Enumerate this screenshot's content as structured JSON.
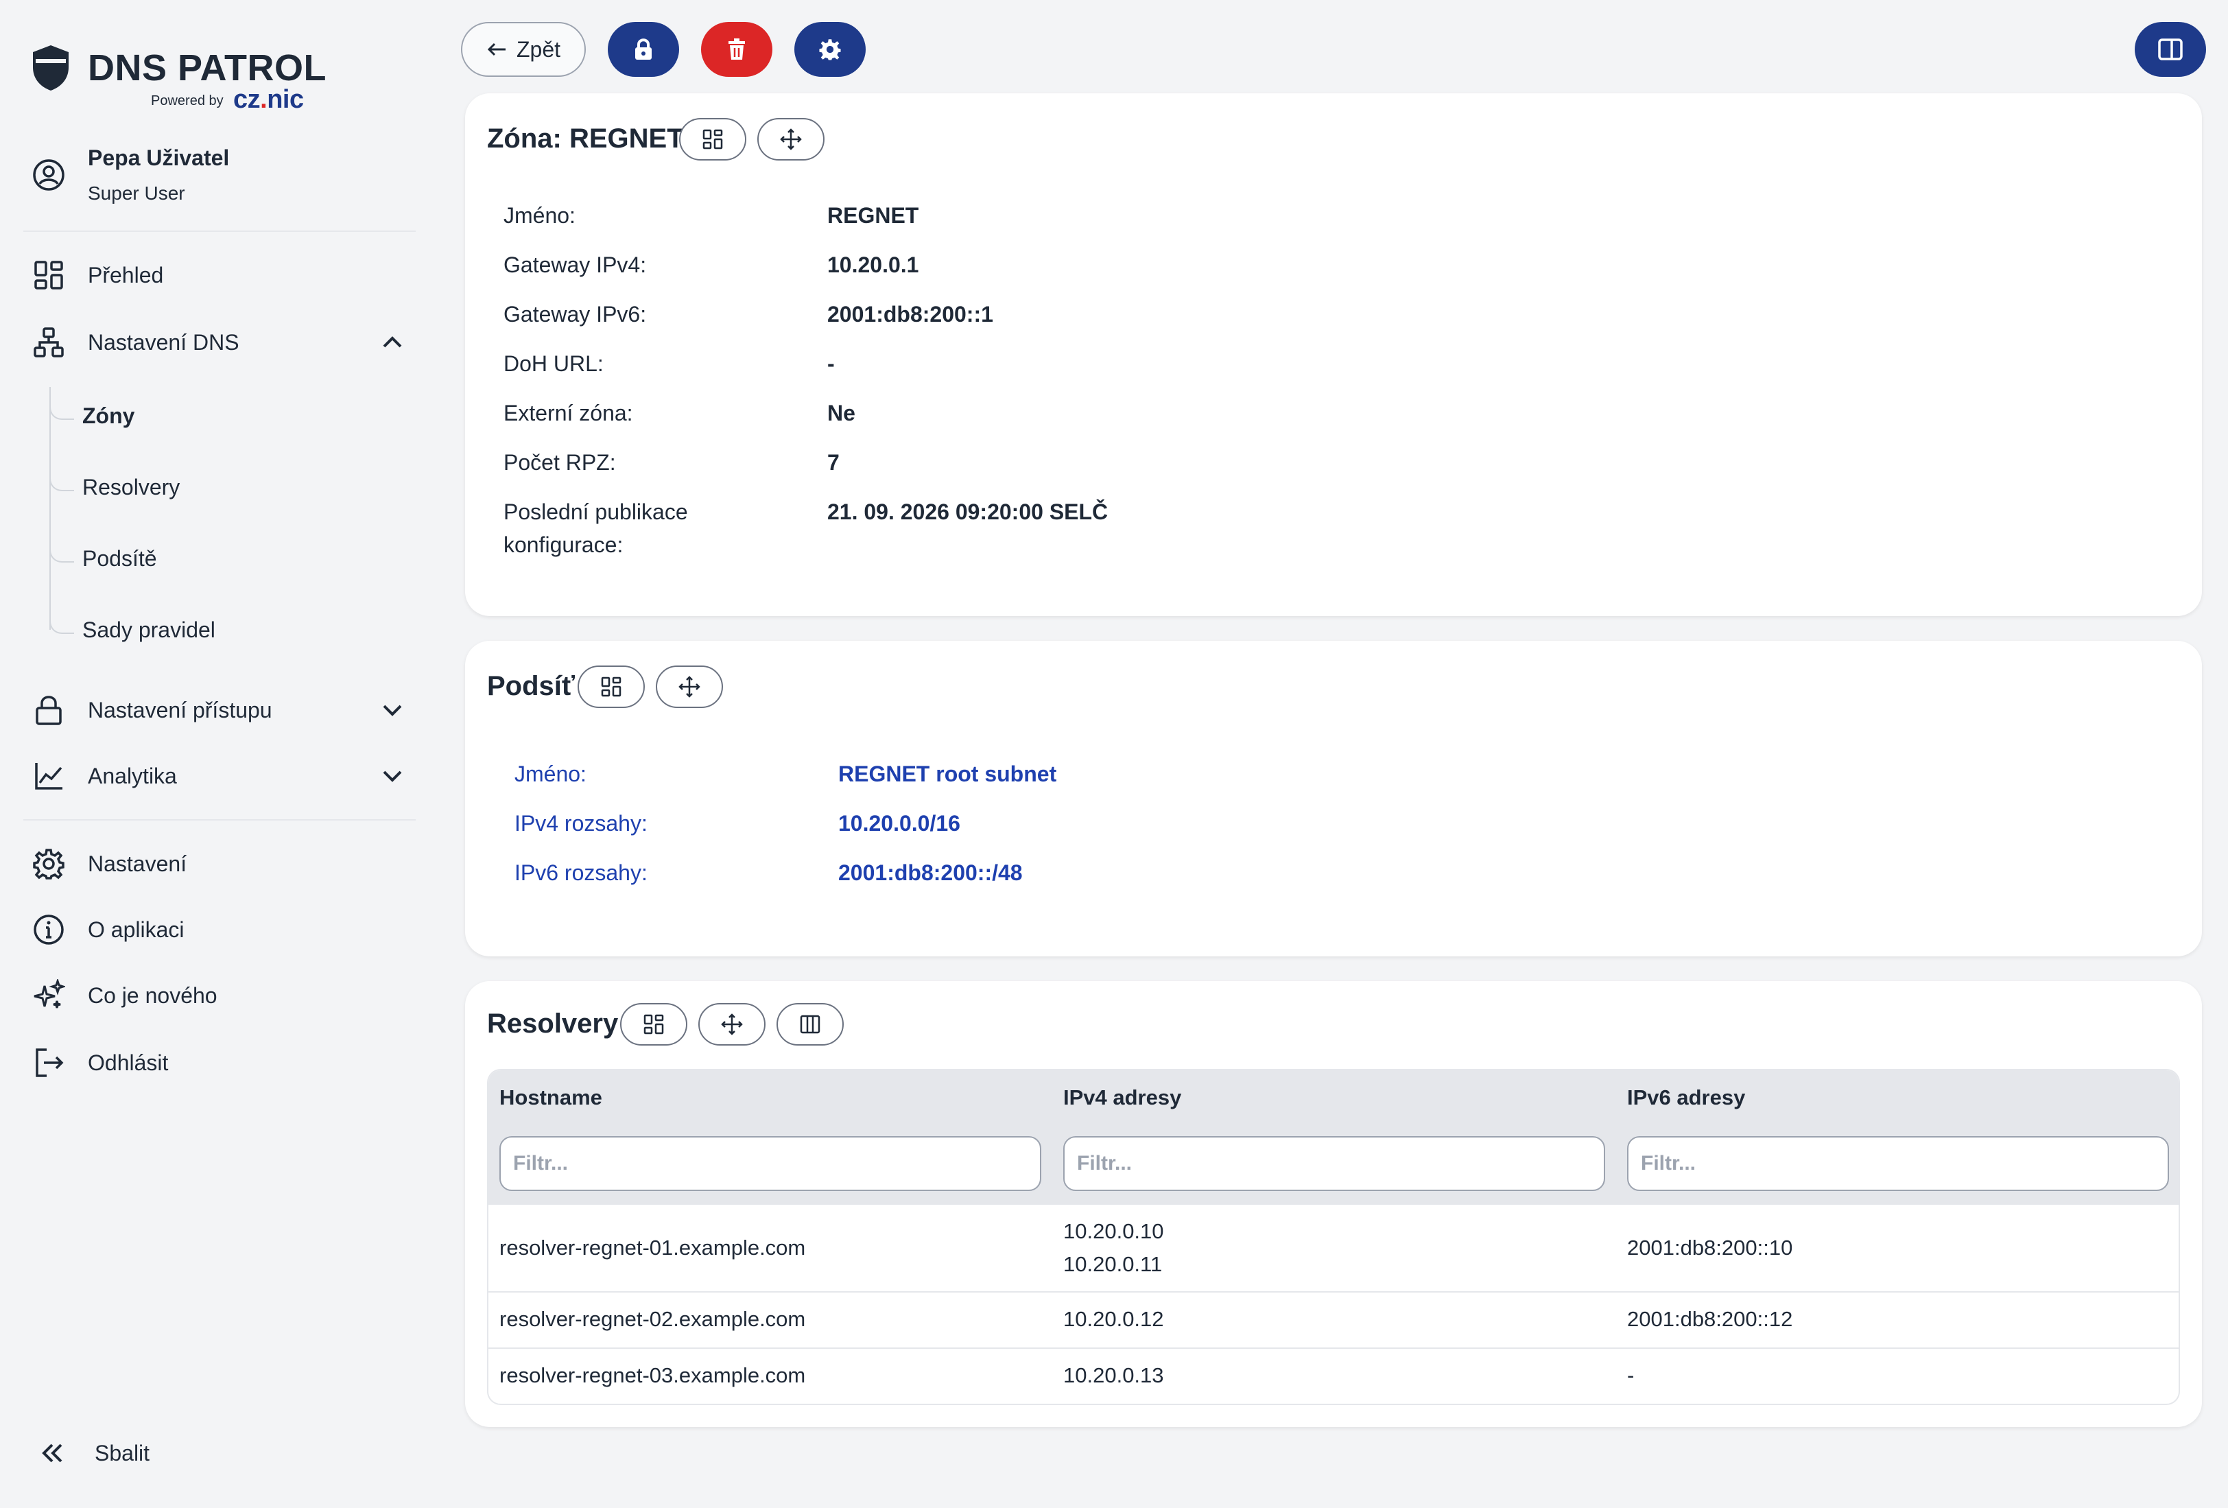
{
  "app": {
    "logo_title": "DNS PATROL",
    "logo_powered": "Powered by",
    "logo_brand_a": "cz",
    "logo_brand_dot": ".",
    "logo_brand_b": "nic"
  },
  "user": {
    "name": "Pepa Uživatel",
    "role": "Super User"
  },
  "sidebar": {
    "overview": "Přehled",
    "dns_settings": "Nastavení DNS",
    "dns_sub": [
      "Zóny",
      "Resolvery",
      "Podsítě",
      "Sady pravidel"
    ],
    "access_settings": "Nastavení přístupu",
    "analytics": "Analytika",
    "settings": "Nastavení",
    "about": "O aplikaci",
    "whats_new": "Co je nového",
    "logout": "Odhlásit",
    "collapse": "Sbalit"
  },
  "toolbar": {
    "back_label": "Zpět"
  },
  "zone": {
    "title": "Zóna: REGNET",
    "rows": [
      {
        "label": "Jméno:",
        "value": "REGNET"
      },
      {
        "label": "Gateway IPv4:",
        "value": "10.20.0.1"
      },
      {
        "label": "Gateway IPv6:",
        "value": "2001:db8:200::1"
      },
      {
        "label": "DoH URL:",
        "value": "-"
      },
      {
        "label": "Externí zóna:",
        "value": "Ne"
      },
      {
        "label": "Počet RPZ:",
        "value": "7"
      },
      {
        "label_line1": "Poslední publikace",
        "label_line2": "konfigurace:",
        "value": "21. 09. 2026 09:20:00 SELČ"
      }
    ]
  },
  "subnet": {
    "title": "Podsíť",
    "rows": [
      {
        "label": "Jméno:",
        "value": "REGNET root subnet"
      },
      {
        "label": "IPv4 rozsahy:",
        "value": "10.20.0.0/16"
      },
      {
        "label": "IPv6 rozsahy:",
        "value": "2001:db8:200::/48"
      }
    ]
  },
  "resolvers": {
    "title": "Resolvery",
    "columns": [
      "Hostname",
      "IPv4 adresy",
      "IPv6 adresy"
    ],
    "filter_placeholder": "Filtr...",
    "rows": [
      {
        "hostname": "resolver-regnet-01.example.com",
        "ipv4": [
          "10.20.0.10",
          "10.20.0.11"
        ],
        "ipv6": "2001:db8:200::10"
      },
      {
        "hostname": "resolver-regnet-02.example.com",
        "ipv4": [
          "10.20.0.12"
        ],
        "ipv6": "2001:db8:200::12"
      },
      {
        "hostname": "resolver-regnet-03.example.com",
        "ipv4": [
          "10.20.0.13"
        ],
        "ipv6": "-"
      }
    ]
  },
  "colors": {
    "primary": "#1e3a8a",
    "danger": "#dc2626",
    "link": "#1e40af",
    "background": "#f3f4f6"
  },
  "icons": [
    "shield-icon",
    "user-circle-icon",
    "dashboard-icon",
    "network-icon",
    "chevron-up-icon",
    "lock-icon",
    "chevron-down-icon",
    "chart-icon",
    "gear-icon",
    "info-icon",
    "sparkles-icon",
    "logout-icon",
    "double-chevron-left-icon",
    "arrow-left-icon",
    "trash-icon",
    "panel-icon",
    "grid-icon",
    "move-icon",
    "columns-icon"
  ]
}
